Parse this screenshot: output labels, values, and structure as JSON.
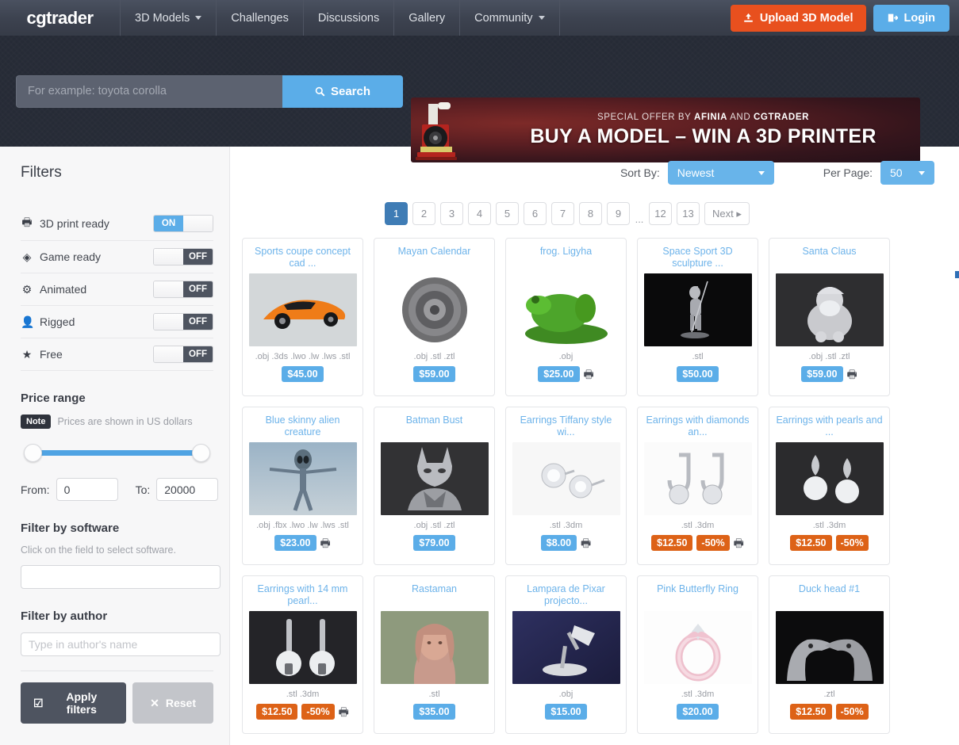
{
  "header": {
    "logo": "cgtrader",
    "nav": [
      {
        "label": "3D Models",
        "has_caret": true
      },
      {
        "label": "Challenges",
        "has_caret": false
      },
      {
        "label": "Discussions",
        "has_caret": false
      },
      {
        "label": "Gallery",
        "has_caret": false
      },
      {
        "label": "Community",
        "has_caret": true
      }
    ],
    "upload_label": "Upload 3D Model",
    "login_label": "Login",
    "upload_color": "#e8501e",
    "login_color": "#5bade8"
  },
  "search": {
    "placeholder": "For example: toyota corolla",
    "value": "",
    "button_label": "Search"
  },
  "banner": {
    "subtitle_pre": "SPECIAL OFFER BY ",
    "subtitle_b1": "AFINIA",
    "subtitle_mid": " AND ",
    "subtitle_b2": "CGTRADER",
    "title": "BUY A MODEL – WIN A 3D PRINTER"
  },
  "sidebar": {
    "title": "Filters",
    "toggles": [
      {
        "label": "3D print ready",
        "state": "ON",
        "icon": "printer-icon"
      },
      {
        "label": "Game ready",
        "state": "OFF",
        "icon": "gamepad-icon"
      },
      {
        "label": "Animated",
        "state": "OFF",
        "icon": "gears-icon"
      },
      {
        "label": "Rigged",
        "state": "OFF",
        "icon": "person-icon"
      },
      {
        "label": "Free",
        "state": "OFF",
        "icon": "star-icon"
      }
    ],
    "price_range": {
      "title": "Price range",
      "note_badge": "Note",
      "note_text": "Prices are shown in US dollars",
      "from_label": "From:",
      "from_value": "0",
      "to_label": "To:",
      "to_value": "20000"
    },
    "software": {
      "title": "Filter by software",
      "hint": "Click on the field to select software.",
      "value": "",
      "placeholder": ""
    },
    "author": {
      "title": "Filter by author",
      "value": "",
      "placeholder": "Type in author's name"
    },
    "apply_label": "Apply filters",
    "reset_label": "Reset"
  },
  "toolbar": {
    "sort_label": "Sort By:",
    "sort_value": "Newest",
    "perpage_label": "Per Page:",
    "perpage_value": "50"
  },
  "pagination": {
    "pages": [
      "1",
      "2",
      "3",
      "4",
      "5",
      "6",
      "7",
      "8",
      "9"
    ],
    "gap": "...",
    "tail_pages": [
      "12",
      "13"
    ],
    "next_label": "Next",
    "active": "1"
  },
  "products": [
    {
      "title": "Sports coupe concept cad ...",
      "formats": ".obj .3ds .lwo .lw .lws .stl",
      "price": "$45.00",
      "discount": null,
      "printable": false,
      "thumb": "car"
    },
    {
      "title": "Mayan Calendar",
      "formats": ".obj .stl .ztl",
      "price": "$59.00",
      "discount": null,
      "printable": false,
      "thumb": "mayan"
    },
    {
      "title": "frog. Ligyha",
      "formats": ".obj",
      "price": "$25.00",
      "discount": null,
      "printable": true,
      "thumb": "frog"
    },
    {
      "title": "Space Sport 3D sculpture ...",
      "formats": ".stl",
      "price": "$50.00",
      "discount": null,
      "printable": false,
      "thumb": "spacesport"
    },
    {
      "title": "Santa Claus",
      "formats": ".obj .stl .ztl",
      "price": "$59.00",
      "discount": null,
      "printable": true,
      "thumb": "santa"
    },
    {
      "title": "Blue skinny alien creature",
      "formats": ".obj .fbx .lwo .lw .lws .stl",
      "price": "$23.00",
      "discount": null,
      "printable": true,
      "thumb": "alien"
    },
    {
      "title": "Batman Bust",
      "formats": ".obj .stl .ztl",
      "price": "$79.00",
      "discount": null,
      "printable": false,
      "thumb": "batman"
    },
    {
      "title": "Earrings Tiffany style wi...",
      "formats": ".stl .3dm",
      "price": "$8.00",
      "discount": null,
      "printable": true,
      "thumb": "tiffany"
    },
    {
      "title": "Earrings with diamonds an...",
      "formats": ".stl .3dm",
      "price": "$12.50",
      "discount": "-50%",
      "printable": true,
      "thumb": "diamondear"
    },
    {
      "title": "Earrings with pearls and ...",
      "formats": ".stl .3dm",
      "price": "$12.50",
      "discount": "-50%",
      "printable": false,
      "thumb": "pearlear"
    },
    {
      "title": "Earrings with 14 mm pearl...",
      "formats": ".stl .3dm",
      "price": "$12.50",
      "discount": "-50%",
      "printable": true,
      "thumb": "pearl14"
    },
    {
      "title": "Rastaman",
      "formats": ".stl",
      "price": "$35.00",
      "discount": null,
      "printable": false,
      "thumb": "rastaman"
    },
    {
      "title": "Lampara de Pixar projecto...",
      "formats": ".obj",
      "price": "$15.00",
      "discount": null,
      "printable": false,
      "thumb": "lamp"
    },
    {
      "title": "Pink Butterfly Ring",
      "formats": ".stl .3dm",
      "price": "$20.00",
      "discount": null,
      "printable": false,
      "thumb": "ring"
    },
    {
      "title": "Duck head #1",
      "formats": ".ztl",
      "price": "$12.50",
      "discount": "-50%",
      "printable": false,
      "thumb": "duck"
    }
  ]
}
